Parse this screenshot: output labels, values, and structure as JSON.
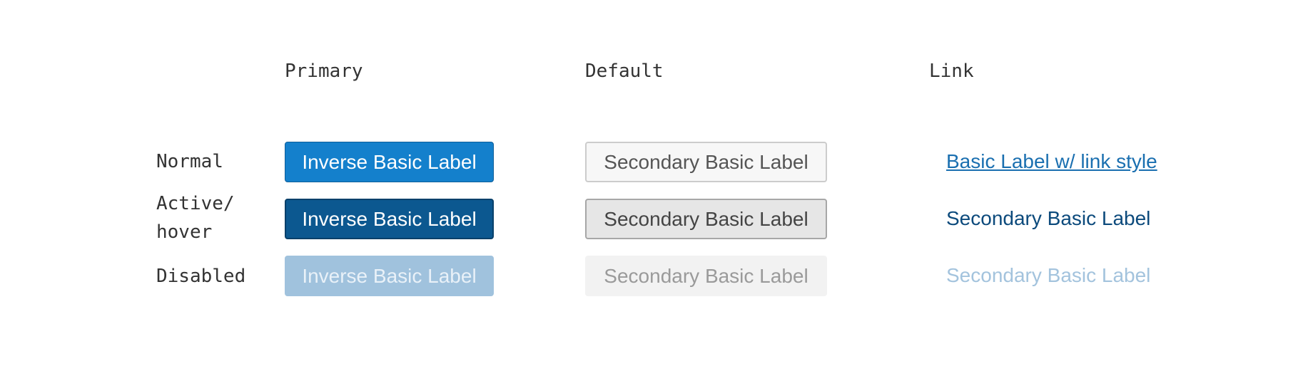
{
  "columns": {
    "primary": "Primary",
    "default": "Default",
    "link": "Link"
  },
  "rows": {
    "normal": "Normal",
    "active_line1": "Active/",
    "active_line2": "hover",
    "disabled": "Disabled"
  },
  "buttons": {
    "primary": {
      "normal": "Inverse Basic Label",
      "active": "Inverse Basic Label",
      "disabled": "Inverse Basic Label"
    },
    "default": {
      "normal": "Secondary Basic Label",
      "active": "Secondary Basic Label",
      "disabled": "Secondary Basic Label"
    },
    "link": {
      "normal": "Basic Label w/ link style",
      "active": "Secondary Basic Label",
      "disabled": "Secondary Basic Label"
    }
  },
  "colors": {
    "primary_normal": "#1480cc",
    "primary_active": "#0c5890",
    "primary_disabled": "#a0c2dd",
    "default_normal_bg": "#f7f7f7",
    "default_active_bg": "#e6e6e6",
    "default_disabled_bg": "#f2f2f2",
    "link_normal": "#1a6fb0",
    "link_active": "#0c4a7c",
    "link_disabled": "#a3c3dd"
  }
}
